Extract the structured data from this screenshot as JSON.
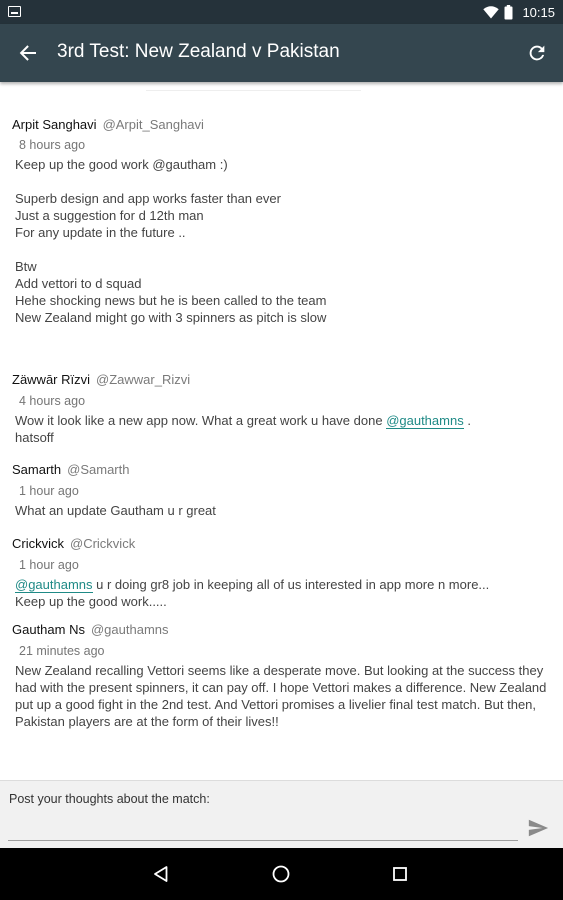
{
  "status_bar": {
    "time": "10:15"
  },
  "app_bar": {
    "title": "3rd Test: New Zealand v Pakistan"
  },
  "comments": [
    {
      "author": "Arpit Sanghavi",
      "handle": "@Arpit_Sanghavi",
      "time": "8 hours ago",
      "body": "Keep up the good work @gautham :)\n\nSuperb design and app works faster than ever\nJust a suggestion for d 12th man\nFor any update in the future ..\n\nBtw\nAdd vettori to d squad\nHehe shocking news but he is been called to the team\nNew Zealand might go with 3 spinners as pitch is slow"
    },
    {
      "author": "Zäwwār Rïzvi",
      "handle": "@Zawwar_Rizvi",
      "time": "4 hours ago",
      "body_before": "Wow it look like a new app now. What a great work u have done ",
      "mention": "@gauthamns",
      "body_after": " .\nhatsoff"
    },
    {
      "author": "Samarth",
      "handle": "@Samarth",
      "time": "1 hour ago",
      "body": "What an update Gautham u r great"
    },
    {
      "author": "Crickvick",
      "handle": "@Crickvick",
      "time": "1 hour ago",
      "mention": "@gauthamns",
      "body_after": " u r doing gr8 job in keeping all of us interested in app more n more...\nKeep up the good work....."
    },
    {
      "author": "Gautham Ns",
      "handle": "@gauthamns",
      "time": "21 minutes ago",
      "body": "New Zealand recalling Vettori seems like a desperate move. But looking at the success they had with the present spinners, it can pay off. I hope Vettori makes a difference. New Zealand put up a good fight in the 2nd test. And Vettori promises a livelier final test match. But then, Pakistan players are at the form of their lives!!"
    }
  ],
  "composer": {
    "label": "Post your thoughts about the match:",
    "value": "",
    "placeholder": ""
  },
  "icons": {
    "back": "arrow-back-icon",
    "refresh": "refresh-icon",
    "send": "send-icon",
    "nav_back": "triangle-back-icon",
    "nav_home": "circle-home-icon",
    "nav_recents": "square-recents-icon"
  },
  "colors": {
    "status_bar": "#25323a",
    "app_bar": "#34464f",
    "mention": "#1f8a86",
    "composer_bg": "#f1f1f1"
  }
}
